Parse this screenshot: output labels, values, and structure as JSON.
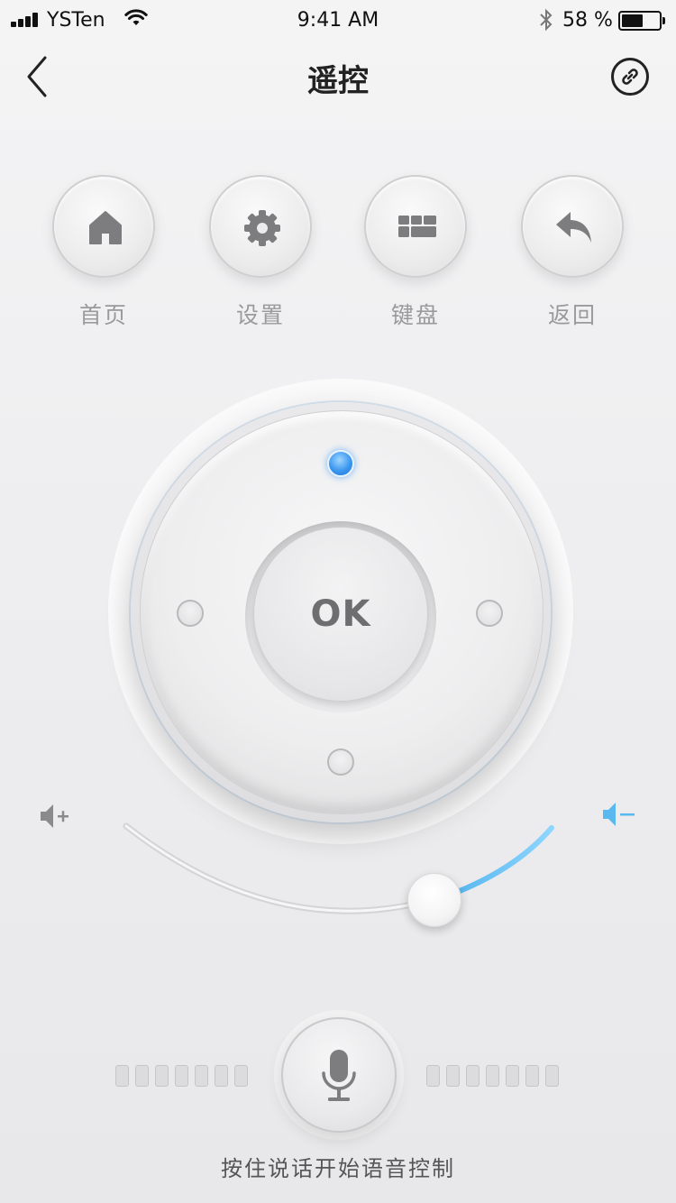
{
  "status_bar": {
    "carrier": "YSTen",
    "time": "9:41 AM",
    "battery_text": "58 %",
    "battery_level": 0.58
  },
  "nav": {
    "title": "遥控",
    "back_icon": "chevron-left-icon",
    "action_icon": "link-icon"
  },
  "quick_actions": [
    {
      "label": "首页",
      "icon": "home-icon"
    },
    {
      "label": "设置",
      "icon": "gear-icon"
    },
    {
      "label": "键盘",
      "icon": "keyboard-icon"
    },
    {
      "label": "返回",
      "icon": "return-icon"
    }
  ],
  "dpad": {
    "ok_label": "OK",
    "active_direction": "up",
    "active_color": "#3c97f0"
  },
  "volume": {
    "up_icon": "volume-up-icon",
    "down_icon": "volume-down-icon",
    "level": 0.3,
    "accent_color": "#5ab8f0"
  },
  "voice": {
    "hint": "按住说话开始语音控制",
    "mic_icon": "microphone-icon"
  }
}
